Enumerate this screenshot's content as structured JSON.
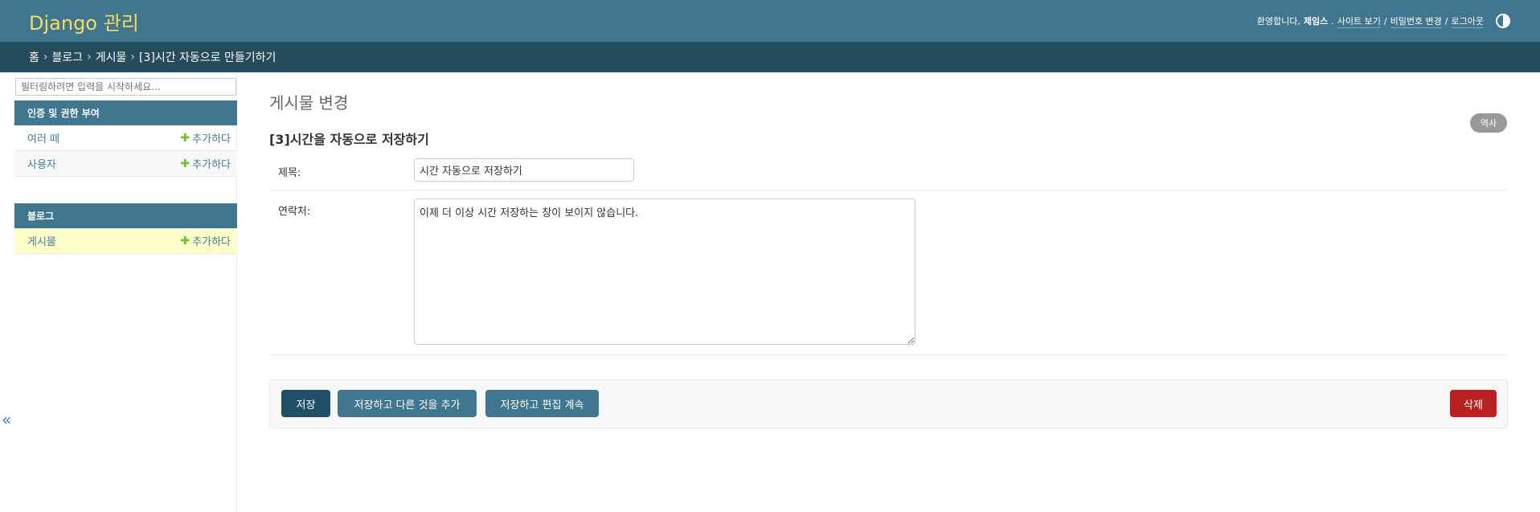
{
  "header": {
    "branding": "Django 관리",
    "welcome": "환영합니다,",
    "username": "제임스",
    "view_site": "사이트 보기",
    "change_password": "비밀번호 변경",
    "logout": "로그아웃",
    "separator": "/",
    "theme_icon": "half-circle-icon"
  },
  "breadcrumbs": {
    "home": "홈",
    "app": "블로그",
    "model": "게시물",
    "current": "[3]시간 자동으로 만들기하기",
    "separator": "›"
  },
  "sidebar": {
    "filter_placeholder": "필터링하려면 입력을 시작하세요...",
    "modules": [
      {
        "caption": "인증 및 권한 부여",
        "rows": [
          {
            "label": "여러 떼",
            "add": "추가하다"
          },
          {
            "label": "사용자",
            "add": "추가하다"
          }
        ]
      },
      {
        "caption": "블로그",
        "rows": [
          {
            "label": "게시물",
            "add": "추가하다"
          }
        ]
      }
    ],
    "toggle": "«"
  },
  "main": {
    "page_title": "게시물 변경",
    "history": "역사",
    "object_title": "[3]시간을 자동으로 저장하기",
    "fields": {
      "title_label": "제목:",
      "title_value": "시간 자동으로 저장하기",
      "content_label": "연락처:",
      "content_value": "이제 더 이상 시간 저장하는 창이 보이지 않습니다."
    },
    "buttons": {
      "save": "저장",
      "save_add": "저장하고 다른 것을 추가",
      "save_continue": "저장하고 편집 계속",
      "delete": "삭제"
    }
  },
  "colors": {
    "header_bg": "#417690",
    "breadcrumbs_bg": "#264b5d",
    "branding": "#f5dd5d",
    "delete": "#ba2121",
    "add_plus": "#70bf2b"
  }
}
